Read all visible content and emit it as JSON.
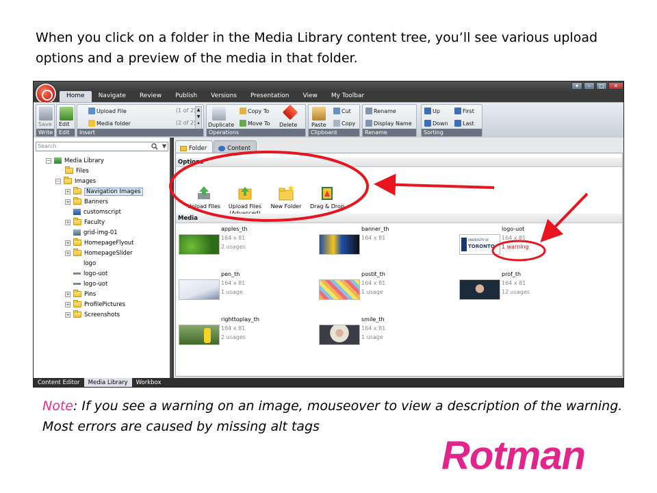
{
  "slide": {
    "heading": "When you click on a folder in the Media Library content tree, you’ll see various upload options and a preview of the media in that folder.",
    "note_label": "Note",
    "note_text": ": If you see a warning on an image, mouseover to view a description of the warning. Most errors are caused by missing alt tags",
    "logo_text": "Rotman",
    "annotation_color": "#e8141e",
    "logo_color": "#e2258a"
  },
  "ribbon": {
    "tabs": [
      "Home",
      "Navigate",
      "Review",
      "Publish",
      "Versions",
      "Presentation",
      "View",
      "My Toolbar"
    ],
    "save": "Save",
    "edit": "Edit",
    "upload_file": "Upload File",
    "upload_file_count": "(1 of 2)",
    "media_folder": "Media folder",
    "media_folder_count": "(2 of 2)",
    "duplicate": "Duplicate",
    "copy_to": "Copy To",
    "move_to": "Move To",
    "delete": "Delete",
    "paste": "Paste",
    "cut": "Cut",
    "copy": "Copy",
    "rename": "Rename",
    "display_name": "Display Name",
    "up": "Up",
    "down": "Down",
    "first": "First",
    "last": "Last",
    "groups": {
      "write": "Write",
      "edit": "Edit",
      "insert": "Insert",
      "operations": "Operations",
      "clipboard": "Clipboard",
      "rename": "Rename",
      "sorting": "Sorting"
    }
  },
  "search": {
    "placeholder": "Search"
  },
  "tree": {
    "media_library": "Media Library",
    "files": "Files",
    "images": "Images",
    "navigation_images": "Navigation Images",
    "banners": "Banners",
    "customscript": "customscript",
    "faculty": "Faculty",
    "grid_img": "grid-img-01",
    "homepage_flyout": "HomepageFlyout",
    "homepage_slider": "HomepageSlider",
    "logo": "logo",
    "logo_uot_1": "logo-uot",
    "logo_uot_2": "logo-uot",
    "pins": "Pins",
    "profile_pictures": "ProfilePictures",
    "screenshots": "Screenshots"
  },
  "bottom_tabs": [
    "Content Editor",
    "Media Library",
    "Workbox"
  ],
  "pane": {
    "tab_folder": "Folder",
    "tab_content": "Content",
    "options_title": "Options",
    "media_title": "Media",
    "options": [
      "Upload Files",
      "Upload Files\n(Advanced)",
      "New Folder",
      "Drag & Drop"
    ]
  },
  "media_items": [
    {
      "name": "apples_th",
      "size": "164 x 81",
      "usage": "2 usages"
    },
    {
      "name": "banner_th",
      "size": "164 x 81",
      "usage": ""
    },
    {
      "name": "logo-uot",
      "size": "164 x 81",
      "usage": "1 warning"
    },
    {
      "name": "pen_th",
      "size": "164 x 81",
      "usage": "1 usage"
    },
    {
      "name": "postit_th",
      "size": "164 x 81",
      "usage": "1 usage"
    },
    {
      "name": "prof_th",
      "size": "164 x 81",
      "usage": "12 usages"
    },
    {
      "name": "righttoplay_th",
      "size": "164 x 81",
      "usage": "2 usages"
    },
    {
      "name": "smile_th",
      "size": "164 x 81",
      "usage": "1 usage"
    }
  ],
  "thumb_text": {
    "toronto": "TORONTO",
    "university_of": "UNIVERSITY OF"
  }
}
